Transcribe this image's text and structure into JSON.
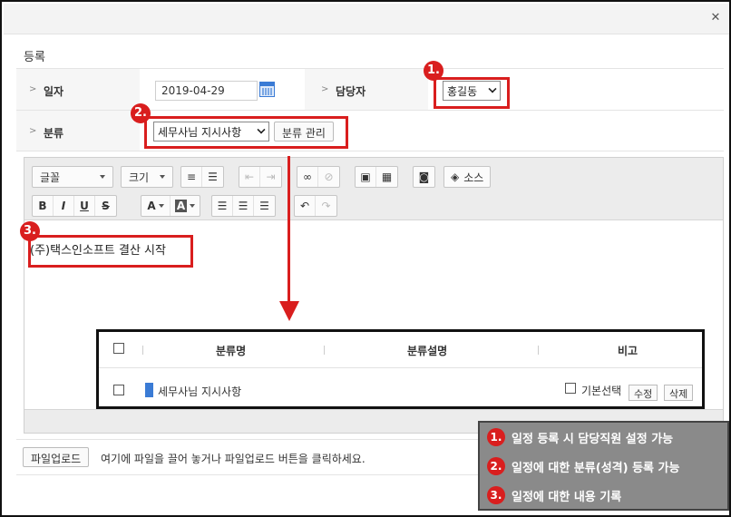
{
  "dialog": {
    "close_glyph": "✕"
  },
  "section_title": "등록",
  "form": {
    "date_label": "일자",
    "date_value": "2019-04-29",
    "manager_label": "담당자",
    "manager_value": "홍길동",
    "category_label": "분류",
    "category_value": "세무사님 지시사항",
    "category_manage_button": "분류 관리"
  },
  "annotations": {
    "badge1": "1.",
    "badge2": "2.",
    "badge3": "3."
  },
  "toolbar": {
    "font_label": "글꼴",
    "size_label": "크기",
    "bold": "B",
    "italic": "I",
    "underline": "U",
    "strike": "S",
    "text_color": "A",
    "bg_color": "A",
    "source_label": "소스"
  },
  "editor": {
    "content": "(주)택스인소프트 결산 시작"
  },
  "category_popup": {
    "columns": [
      "분류명",
      "분류설명",
      "비고"
    ],
    "rows": [
      {
        "name": "세무사님 지시사항",
        "description": "",
        "default_label": "기본선택",
        "edit_label": "수정",
        "delete_label": "삭제"
      }
    ]
  },
  "upload": {
    "button_label": "파일업로드",
    "hint": "여기에 파일을 끌어 놓거나 파일업로드 버튼을 클릭하세요."
  },
  "legend": {
    "items": [
      {
        "num": "1.",
        "text": "일정 등록 시 담당직원 설정 가능"
      },
      {
        "num": "2.",
        "text": "일정에 대한 분류(성격) 등록 가능"
      },
      {
        "num": "3.",
        "text": "일정에 대한 내용 기록"
      }
    ]
  },
  "colors": {
    "accent_red": "#d91e1e",
    "accent_blue": "#3a7bd5",
    "legend_bg": "#8a8a8a"
  }
}
